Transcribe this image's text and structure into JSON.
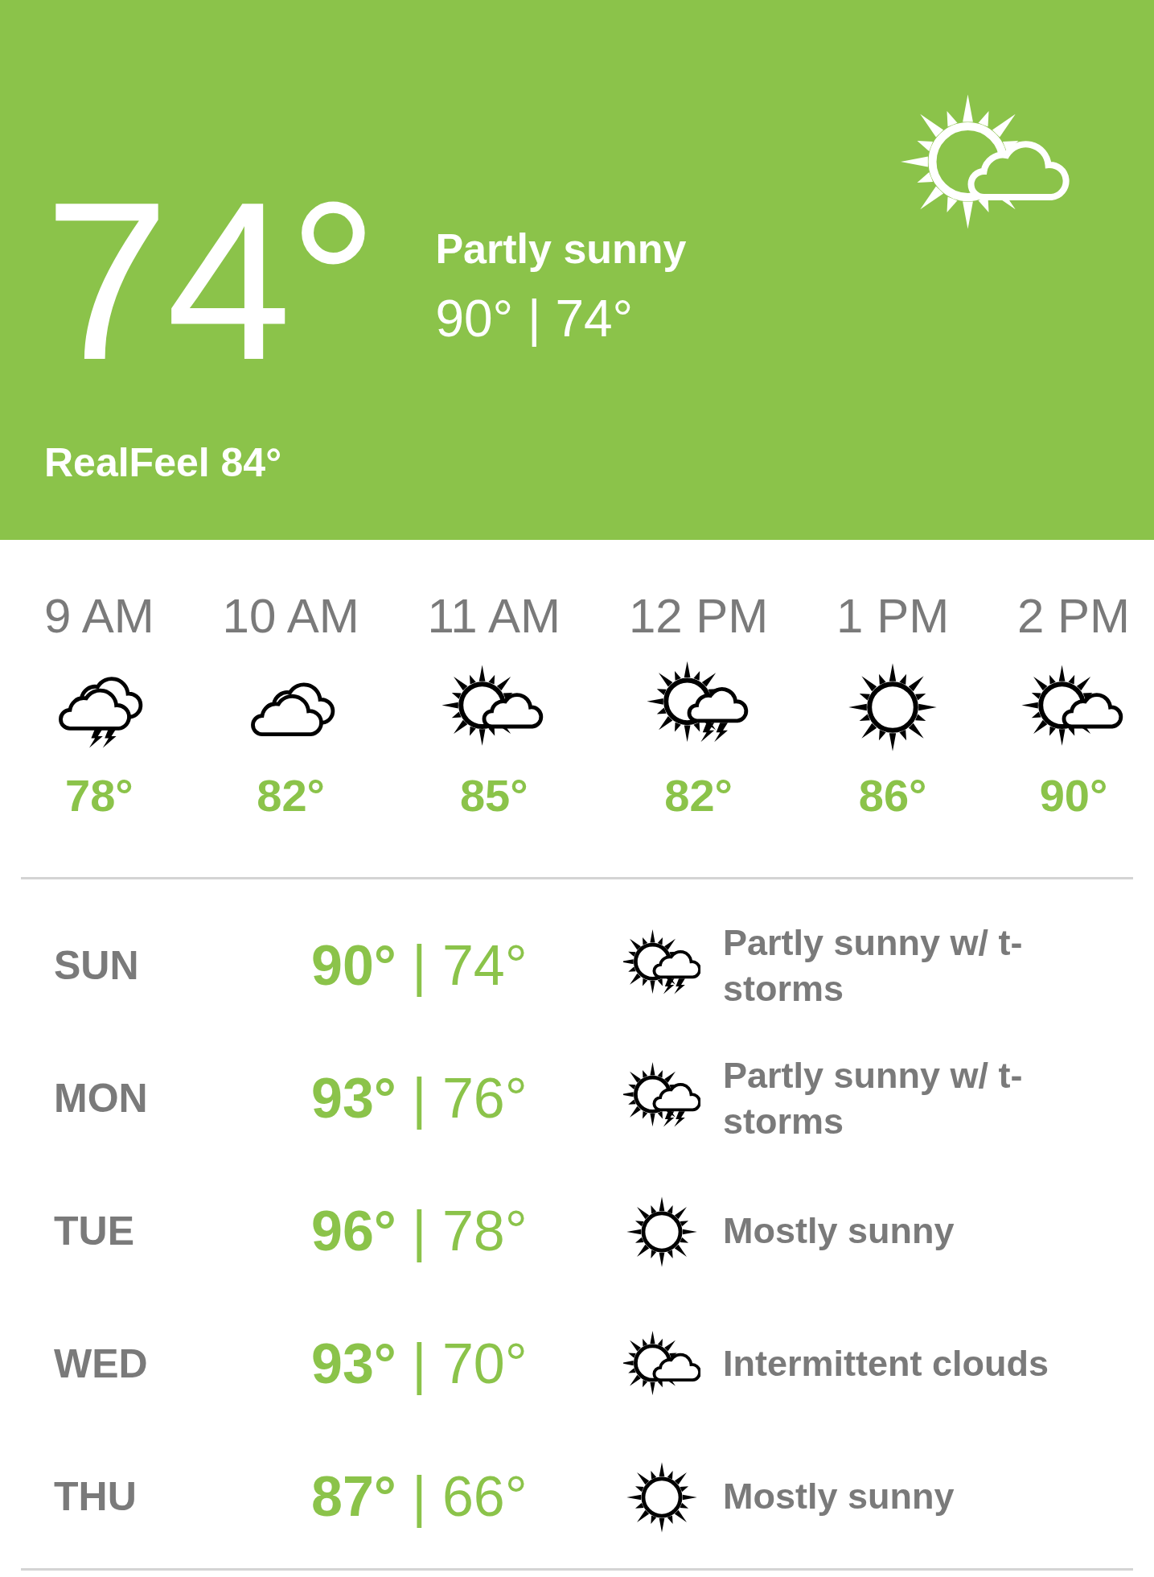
{
  "current": {
    "temp": "74°",
    "condition": "Partly sunny",
    "high_low": "90° | 74°",
    "realfeel": "RealFeel 84°",
    "kind": "partly-sunny"
  },
  "hourly": [
    {
      "time": "9 AM",
      "kind": "storm-cloud",
      "temp": "78°"
    },
    {
      "time": "10 AM",
      "kind": "cloudy",
      "temp": "82°"
    },
    {
      "time": "11 AM",
      "kind": "partly-sunny",
      "temp": "85°"
    },
    {
      "time": "12 PM",
      "kind": "partly-sunny-storm",
      "temp": "82°"
    },
    {
      "time": "1 PM",
      "kind": "sunny",
      "temp": "86°"
    },
    {
      "time": "2 PM",
      "kind": "partly-sunny",
      "temp": "90°"
    }
  ],
  "daily": [
    {
      "day": "SUN",
      "temps": "**90°** | 74°",
      "kind": "partly-sunny-storm",
      "description": "Partly sunny w/ t-storms"
    },
    {
      "day": "MON",
      "temps": "**93°** | 76°",
      "kind": "partly-sunny-storm",
      "description": "Partly sunny w/ t-storms"
    },
    {
      "day": "TUE",
      "temps": "**96°** | 78°",
      "kind": "sunny",
      "description": "Mostly sunny"
    },
    {
      "day": "WED",
      "temps": "**93°** | 70°",
      "kind": "partly-sunny",
      "description": "Intermittent clouds"
    },
    {
      "day": "THU",
      "temps": "**87°** | 66°",
      "kind": "sunny",
      "description": "Mostly sunny"
    }
  ]
}
